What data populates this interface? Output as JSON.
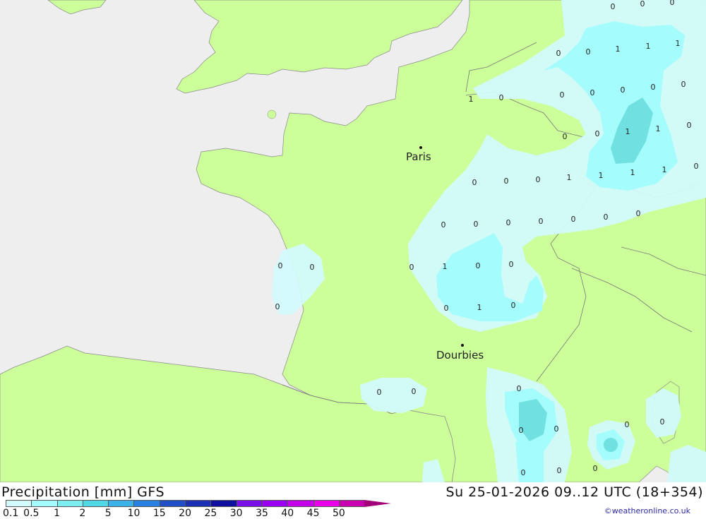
{
  "map": {
    "sea_color": "#eeeeee",
    "land_color": "#ccff99",
    "precip_light_color": "#d2fafc",
    "precip_mid_color": "#a4fcfc",
    "precip_high_color": "#70e0e0",
    "cities": [
      {
        "name": "Paris"
      },
      {
        "name": "Dourbies"
      }
    ],
    "value_labels": [
      "0",
      "0",
      "0",
      "1",
      "1",
      "1",
      "0",
      "0",
      "1",
      "0",
      "0",
      "0",
      "0",
      "0",
      "0",
      "1",
      "1",
      "0",
      "0",
      "0",
      "1",
      "1",
      "1",
      "1",
      "0",
      "0",
      "0",
      "0",
      "0",
      "0",
      "0",
      "0",
      "0",
      "0",
      "0",
      "0",
      "1",
      "0",
      "0",
      "0",
      "1",
      "0",
      "0",
      "0",
      "0",
      "0",
      "0",
      "0",
      "0",
      "0",
      "0",
      "0",
      "0",
      "0",
      "0"
    ]
  },
  "footer": {
    "title": "Precipitation [mm] GFS",
    "datetime": "Su 25-01-2026 09..12 UTC (18+354)",
    "credit": "©weatheronline.co.uk",
    "legend": {
      "colors": [
        "#d2fafc",
        "#a4fcfc",
        "#7cf0f0",
        "#50d8e6",
        "#3cb0e8",
        "#2880e0",
        "#2050c8",
        "#1c30b4",
        "#1010a0",
        "#7a10e8",
        "#9c00f0",
        "#c400e8",
        "#e800e8",
        "#c800b0",
        "#a20078"
      ],
      "labels": [
        "0.1",
        "0.5",
        "1",
        "2",
        "5",
        "10",
        "15",
        "20",
        "25",
        "30",
        "35",
        "40",
        "45",
        "50"
      ]
    }
  }
}
